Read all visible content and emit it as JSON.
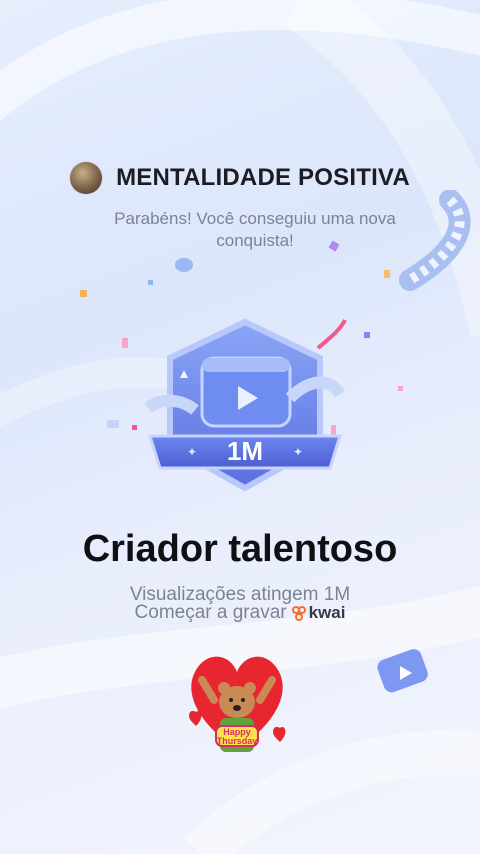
{
  "header": {
    "channel_name": "MENTALIDADE POSITIVA",
    "avatar_icon": "profile-avatar"
  },
  "congrats_text": "Parabéns! Você conseguiu uma nova conquista!",
  "badge": {
    "milestone_label": "1M",
    "icon": "video-play-badge-icon"
  },
  "achievement_title": "Criador talentoso",
  "achievement_description": "Visualizações atingem 1M",
  "cta": {
    "text": "Começar a gravar",
    "brand": "kwai"
  },
  "sticker": {
    "text_line1": "Happy",
    "text_line2": "Thursday"
  },
  "colors": {
    "accent_blue": "#5b6fe0",
    "confetti_pink": "#f05a8c",
    "confetti_orange": "#f5b25a",
    "kwai_orange": "#ff6a2a"
  }
}
